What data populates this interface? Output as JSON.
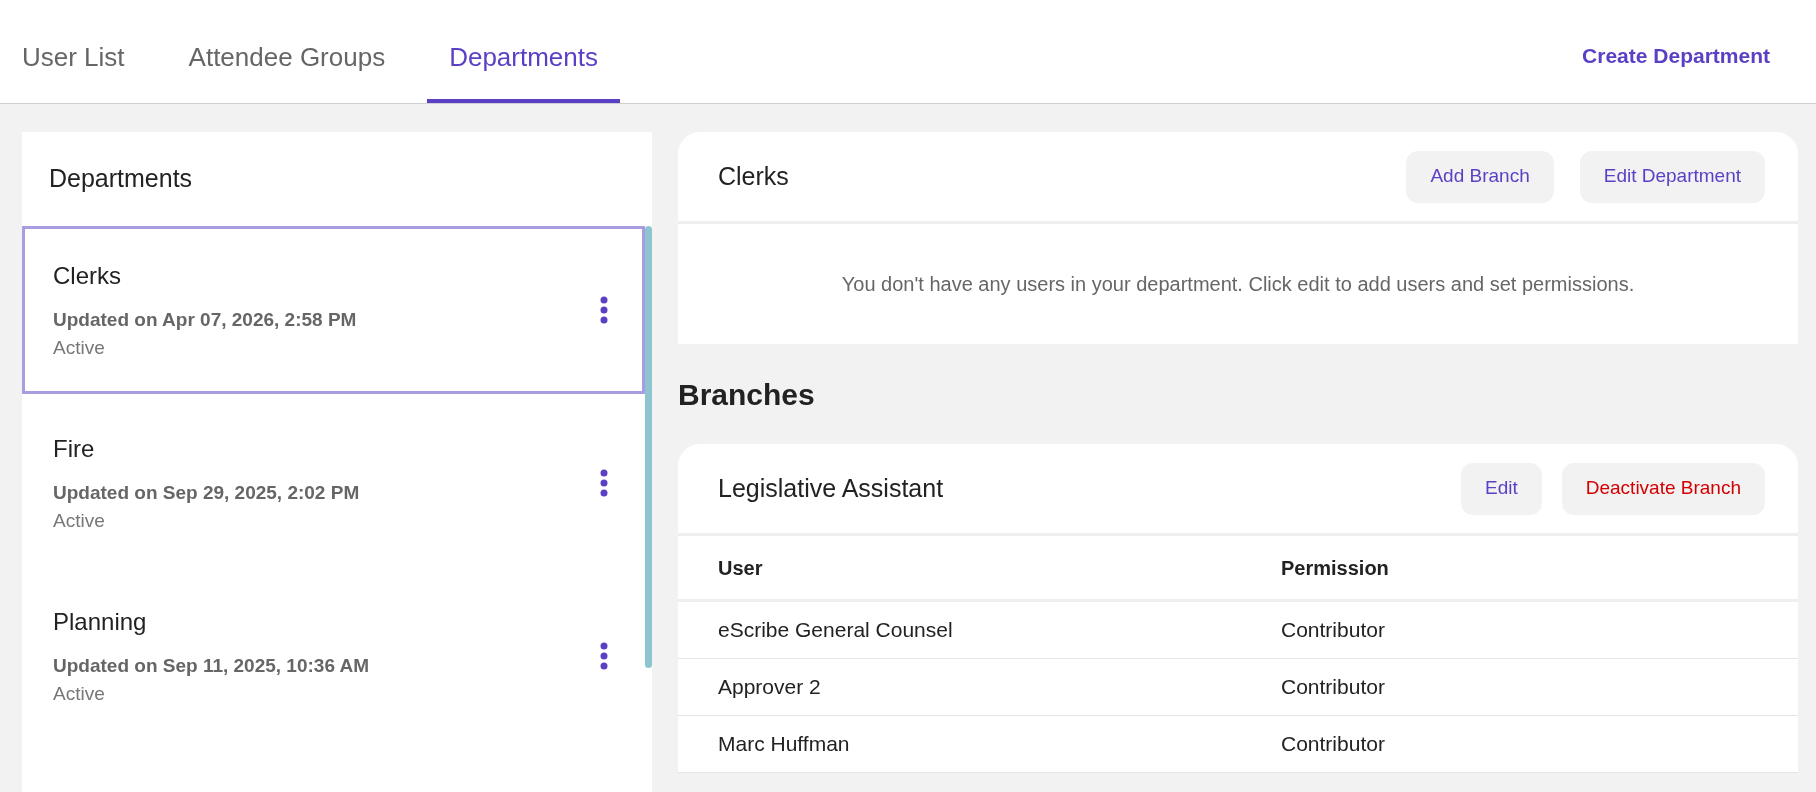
{
  "tabs": [
    {
      "label": "User List",
      "selected": false
    },
    {
      "label": "Attendee Groups",
      "selected": false
    },
    {
      "label": "Departments",
      "selected": true
    }
  ],
  "create_button": "Create Department",
  "departments_panel": {
    "title": "Departments",
    "items": [
      {
        "name": "Clerks",
        "updated": "Updated on Apr 07, 2026, 2:58 PM",
        "status": "Active",
        "selected": true
      },
      {
        "name": "Fire",
        "updated": "Updated on Sep 29, 2025, 2:02 PM",
        "status": "Active",
        "selected": false
      },
      {
        "name": "Planning",
        "updated": "Updated on Sep 11, 2025, 10:36 AM",
        "status": "Active",
        "selected": false
      }
    ]
  },
  "department_detail": {
    "title": "Clerks",
    "buttons": [
      {
        "label": "Add Branch",
        "kind": "normal"
      },
      {
        "label": "Edit Department",
        "kind": "normal"
      }
    ],
    "empty_message": "You don't have any users in your department. Click edit to add users and set permissions."
  },
  "branches": {
    "title": "Branches",
    "items": [
      {
        "name": "Legislative Assistant",
        "buttons": [
          {
            "label": "Edit",
            "kind": "normal"
          },
          {
            "label": "Deactivate Branch",
            "kind": "danger"
          }
        ],
        "columns": [
          "User",
          "Permission"
        ],
        "rows": [
          [
            "eScribe General Counsel",
            "Contributor"
          ],
          [
            "Approver 2",
            "Contributor"
          ],
          [
            "Marc Huffman",
            "Contributor"
          ]
        ]
      }
    ]
  }
}
